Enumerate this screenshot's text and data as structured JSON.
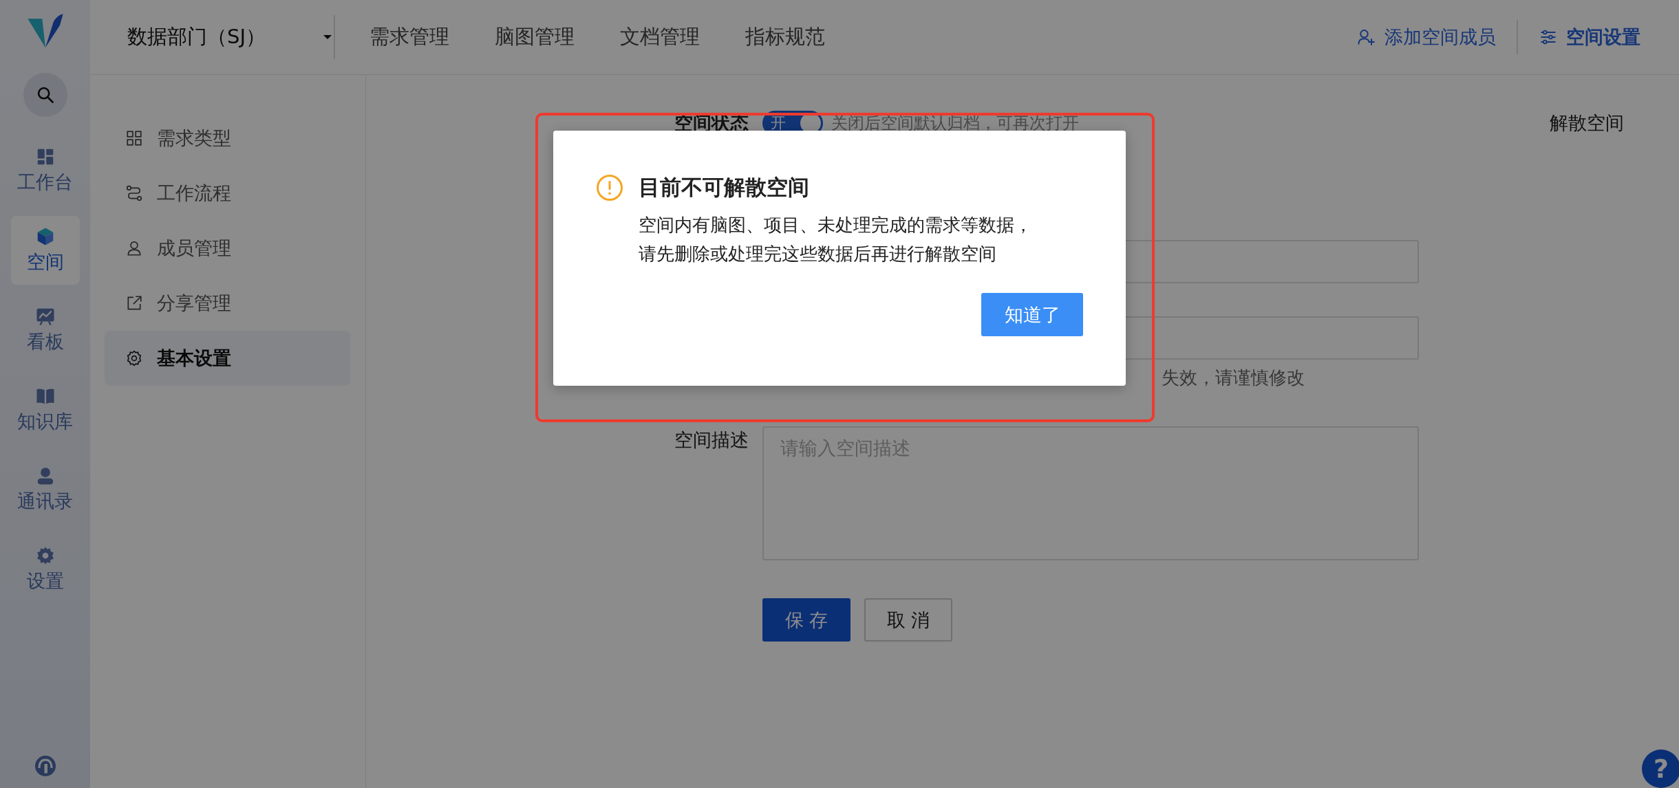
{
  "nav": {
    "items": [
      {
        "label": "工作台",
        "selected": false
      },
      {
        "label": "空间",
        "selected": true
      },
      {
        "label": "看板",
        "selected": false
      },
      {
        "label": "知识库",
        "selected": false
      },
      {
        "label": "通讯录",
        "selected": false
      },
      {
        "label": "设置",
        "selected": false
      }
    ]
  },
  "space_selector": {
    "value": "数据部门（SJ）"
  },
  "tabs": [
    {
      "label": "需求管理",
      "selected": false
    },
    {
      "label": "脑图管理",
      "selected": false
    },
    {
      "label": "文档管理",
      "selected": false
    },
    {
      "label": "指标规范",
      "selected": false
    }
  ],
  "header_actions": [
    {
      "label": "添加空间成员",
      "kind": "link"
    },
    {
      "label": "空间设置",
      "kind": "primary"
    }
  ],
  "submenu": [
    {
      "label": "需求类型",
      "selected": false
    },
    {
      "label": "工作流程",
      "selected": false
    },
    {
      "label": "成员管理",
      "selected": false
    },
    {
      "label": "分享管理",
      "selected": false
    },
    {
      "label": "基本设置",
      "selected": true
    }
  ],
  "dissolve_link": "解散空间",
  "form": {
    "status": {
      "label": "空间状态",
      "switch_text": "开",
      "on": true,
      "hint": "关闭后空间默认归档，可再次打开"
    },
    "code_hint": "失效，请谨慎修改",
    "description": {
      "label": "空间描述",
      "placeholder": "请输入空间描述"
    },
    "buttons": [
      {
        "label": "保 存",
        "kind": "primary"
      },
      {
        "label": "取 消",
        "kind": "default"
      }
    ]
  },
  "dialog": {
    "title": "目前不可解散空间",
    "message": [
      "空间内有脑图、项目、未处理完成的需求等数据，",
      "请先删除或处理完这些数据后再进行解散空间"
    ],
    "button": "知道了"
  },
  "help_button": {
    "label": "?"
  }
}
